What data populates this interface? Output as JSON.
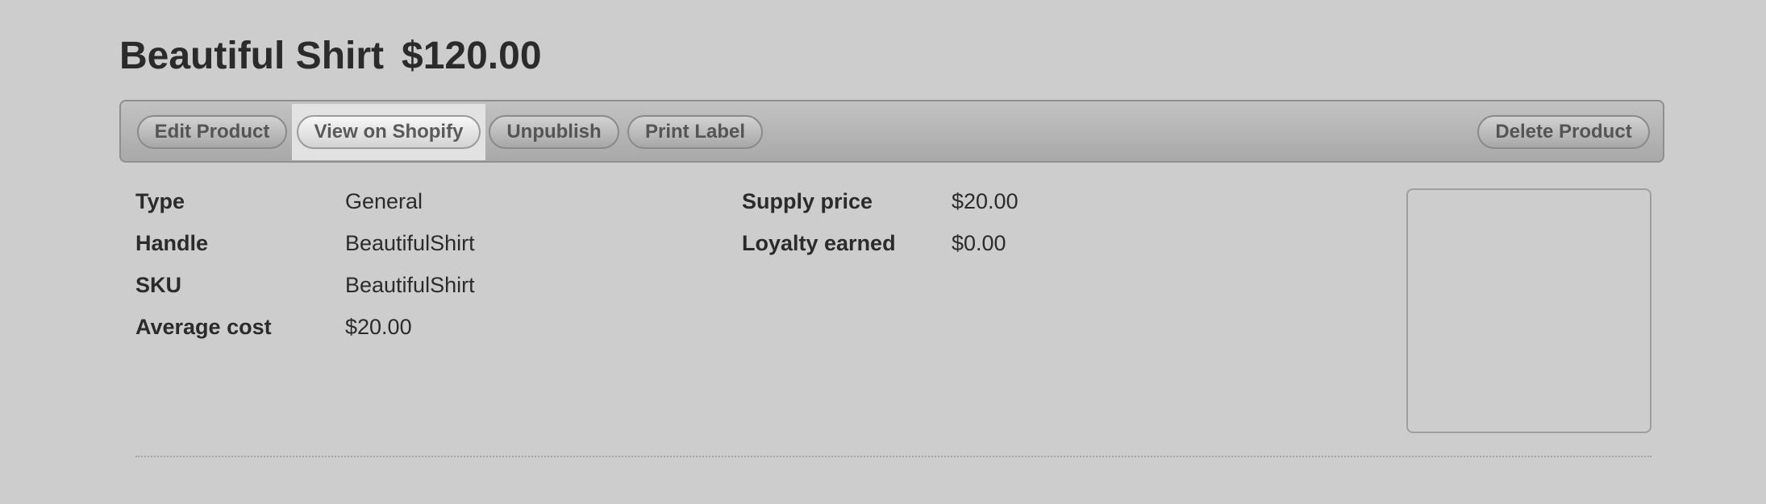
{
  "product": {
    "title": "Beautiful Shirt",
    "price": "$120.00"
  },
  "toolbar": {
    "edit": "Edit Product",
    "view": "View on Shopify",
    "unpublish": "Unpublish",
    "print": "Print Label",
    "delete": "Delete Product"
  },
  "details": {
    "type_label": "Type",
    "type_value": "General",
    "handle_label": "Handle",
    "handle_value": "BeautifulShirt",
    "sku_label": "SKU",
    "sku_value": "BeautifulShirt",
    "avg_cost_label": "Average cost",
    "avg_cost_value": "$20.00",
    "supply_price_label": "Supply price",
    "supply_price_value": "$20.00",
    "loyalty_label": "Loyalty earned",
    "loyalty_value": "$0.00"
  },
  "colors": {
    "background": "#cdcdcd",
    "text": "#2b2b2b",
    "button_text": "#555555"
  }
}
